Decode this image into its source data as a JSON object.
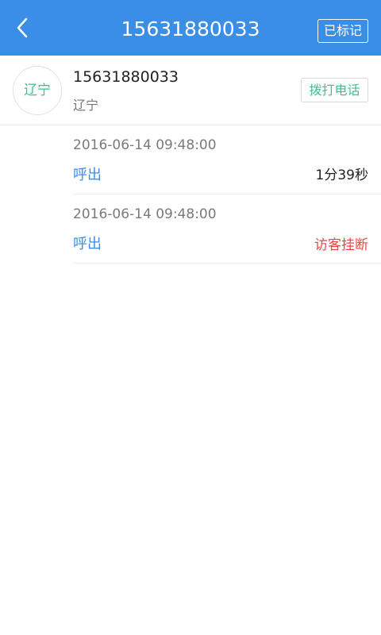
{
  "header": {
    "title": "15631880033",
    "marked_label": "已标记",
    "back_icon": "chevron-left-icon"
  },
  "contact": {
    "avatar_text": "辽宁",
    "number": "15631880033",
    "region": "辽宁",
    "dial_label": "拨打电话"
  },
  "records": [
    {
      "time": "2016-06-14 09:48:00",
      "type": "呼出",
      "duration": "1分39秒"
    },
    {
      "time": "2016-06-14 09:48:00",
      "type": "呼出",
      "status": "访客挂断"
    }
  ],
  "colors": {
    "header_bg": "#3a8ee6",
    "accent_green": "#3ec28b",
    "call_type_blue": "#3a8ee6",
    "status_red": "#ee4444"
  }
}
